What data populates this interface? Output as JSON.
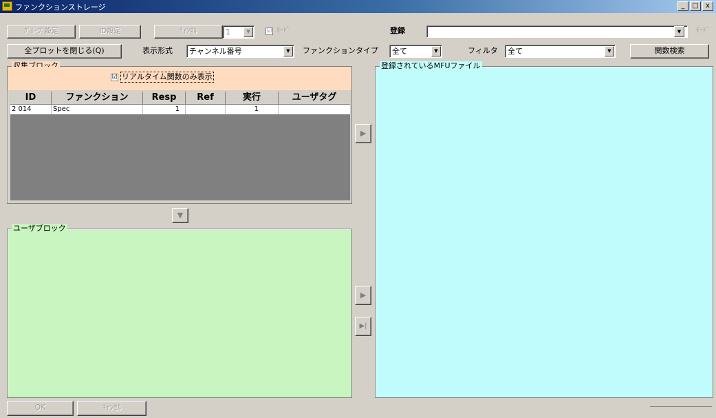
{
  "window": {
    "title": "ファンクションストレージ",
    "min": "_",
    "max": "□",
    "close": "x"
  },
  "toolbar1": {
    "btn1": "ｸﾞﾙｰﾌﾟ設定",
    "btn2": "ID設定",
    "btn3": "ﾁｬﾝﾈﾙ",
    "spin_value": "1",
    "check_mark": "☑",
    "check_label": "ﾓｰﾄﾞ",
    "register_label": "登録",
    "right_text": "ﾓｰﾄﾞ"
  },
  "toolbar2": {
    "close_all": "全プロットを閉じる(Q)",
    "display_label": "表示形式",
    "display_value": "チャンネル番号",
    "ftype_label": "ファンクションタイプ",
    "ftype_value": "全て",
    "filter_label": "フィルタ",
    "filter_value": "全て",
    "search": "関数検索"
  },
  "collect": {
    "title": "収集ブロック",
    "realtime_check": "☑",
    "realtime_label": "リアルタイム関数のみ表示",
    "columns": [
      "ID",
      "ファンクション",
      "Resp",
      "Ref",
      "実行",
      "ユーザタグ"
    ],
    "rows": [
      {
        "id": "2 014",
        "func": "Spec",
        "resp": "1",
        "ref": "",
        "exec": "1",
        "tag": ""
      }
    ]
  },
  "down_arrow": "▼",
  "right_arrow": "▶",
  "last_arrow": "▶|",
  "user_block": {
    "title": "ユーザブロック"
  },
  "mfu": {
    "title": "登録されているMFUファイル"
  },
  "bottom": {
    "btn1": "OK",
    "btn2": "ｷｬﾝｾﾙ"
  }
}
